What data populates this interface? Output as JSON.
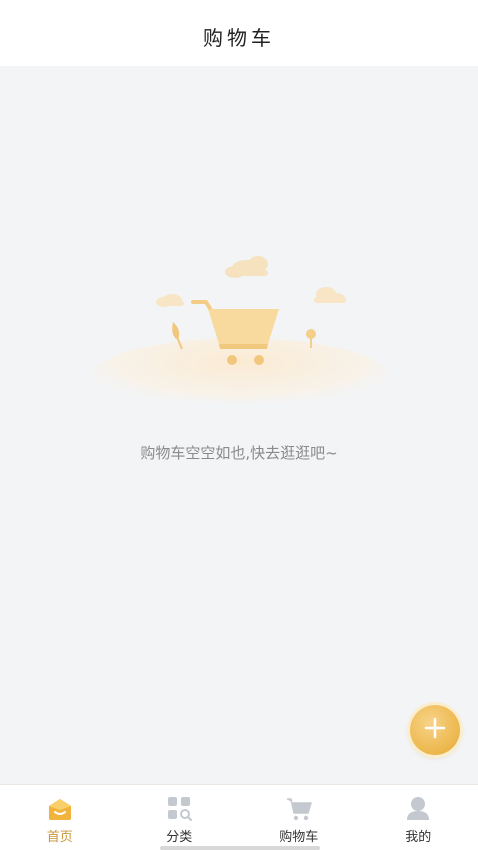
{
  "header": {
    "title": "购物车"
  },
  "empty_state": {
    "message": "购物车空空如也,快去逛逛吧~",
    "icon": "empty-cart-illustration"
  },
  "fab": {
    "icon": "plus-icon"
  },
  "tabbar": {
    "items": [
      {
        "label": "首页",
        "icon": "home-icon",
        "active": true
      },
      {
        "label": "分类",
        "icon": "category-icon",
        "active": false
      },
      {
        "label": "购物车",
        "icon": "cart-icon",
        "active": false
      },
      {
        "label": "我的",
        "icon": "user-icon",
        "active": false
      }
    ]
  },
  "colors": {
    "accent": "#c8963a",
    "fab": "#eebb54",
    "background": "#f3f4f6"
  }
}
